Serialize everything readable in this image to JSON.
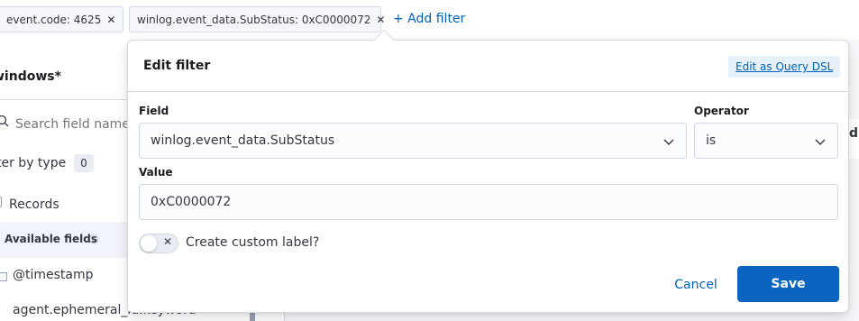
{
  "filter_bar": {
    "pills": [
      {
        "label": "event.code: 4625"
      },
      {
        "label": "winlog.event_data.SubStatus: 0xC0000072"
      }
    ],
    "add_filter_label": "+ Add filter"
  },
  "sidebar": {
    "index_pattern": "windows*",
    "search_placeholder": "Search field names",
    "filter_by_type_label": "ter by type",
    "filter_by_type_count": "0",
    "records_label": "Records",
    "available_fields_label": "Available fields",
    "fields": [
      "@timestamp",
      "agent.ephemeral_id.keyword"
    ]
  },
  "main": {
    "tab_fragment": "d"
  },
  "edit_filter": {
    "title": "Edit filter",
    "query_dsl_link": "Edit as Query DSL",
    "field_label": "Field",
    "field_value": "winlog.event_data.SubStatus",
    "operator_label": "Operator",
    "operator_value": "is",
    "value_label": "Value",
    "value_value": "0xC0000072",
    "custom_label_toggle": "Create custom label?",
    "custom_label_enabled": false,
    "cancel_label": "Cancel",
    "save_label": "Save"
  },
  "colors": {
    "accent": "#0b64c0",
    "link": "#0061b8"
  },
  "icons": {
    "pill_close": "close-icon",
    "search": "search-icon",
    "help": "help-icon",
    "dropdown": "chevron-down-icon",
    "toggle_off": "cross-icon"
  }
}
